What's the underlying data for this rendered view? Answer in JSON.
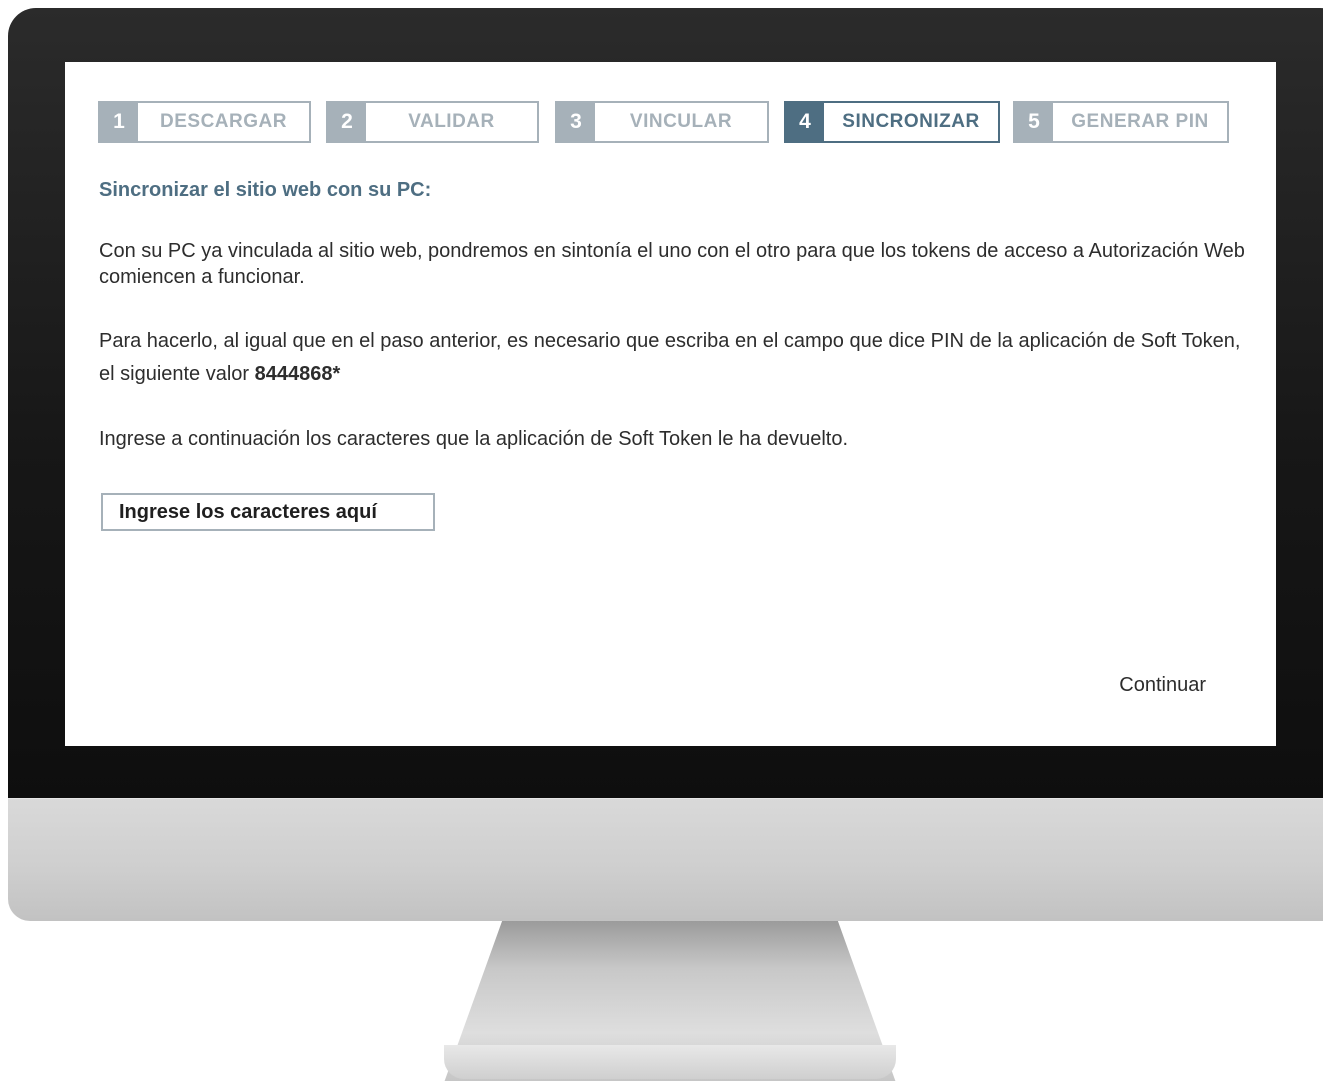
{
  "steps": [
    {
      "number": "1",
      "label": "DESCARGAR",
      "active": false
    },
    {
      "number": "2",
      "label": "VALIDAR",
      "active": false
    },
    {
      "number": "3",
      "label": "VINCULAR",
      "active": false
    },
    {
      "number": "4",
      "label": "SINCRONIZAR",
      "active": true
    },
    {
      "number": "5",
      "label": "GENERAR PIN",
      "active": false
    }
  ],
  "content": {
    "title": "Sincronizar el sitio web con su PC:",
    "paragraph1": "Con su PC ya vinculada al sitio web, pondremos en sintonía el uno con el otro para que los tokens de acceso a Autorización Web comiencen a funcionar.",
    "paragraph2_text": "Para hacerlo, al igual que en el paso anterior, es necesario que escriba en el campo que dice PIN de la aplicación de Soft Token, el siguiente valor ",
    "paragraph2_value": "8444868*",
    "paragraph3": "Ingrese a continuación los caracteres que la aplicación de Soft Token le ha devuelto."
  },
  "input": {
    "placeholder": "Ingrese los caracteres aquí",
    "value": ""
  },
  "actions": {
    "continue_label": "Continuar"
  },
  "colors": {
    "active_step": "#4e6e82",
    "inactive_step": "#a6b1b9",
    "title": "#4e6e82",
    "text": "#2d2d2d"
  }
}
